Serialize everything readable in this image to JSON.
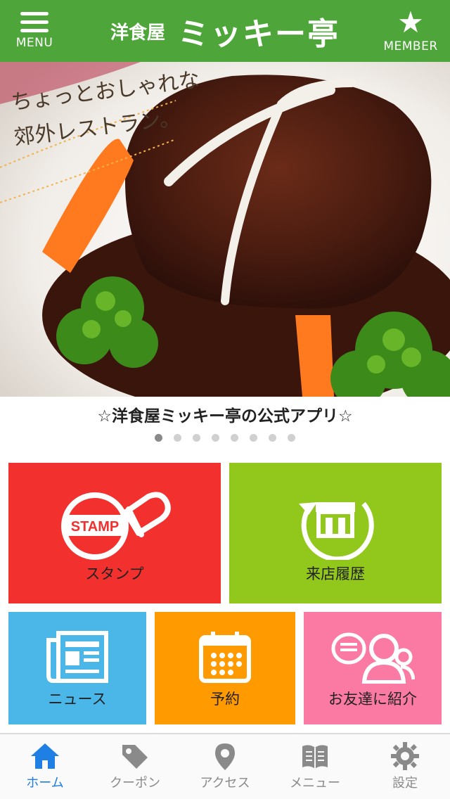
{
  "header": {
    "menu_label": "MENU",
    "member_label": "MEMBER",
    "title_prefix": "洋食屋",
    "title_main": "ミッキー亭",
    "brand_color": "#4ea63a"
  },
  "hero": {
    "tagline_line1": "ちょっとおしゃれな",
    "tagline_line2": "郊外レストラン。",
    "caption": "☆洋食屋ミッキー亭の公式アプリ☆",
    "slide_count": 8,
    "active_slide": 1
  },
  "tiles": {
    "stamp": {
      "label": "スタンプ",
      "badge": "STAMP",
      "color": "#f2302d"
    },
    "history": {
      "label": "来店履歴",
      "color": "#92c81c"
    },
    "news": {
      "label": "ニュース",
      "color": "#4ab7e8"
    },
    "reserve": {
      "label": "予約",
      "color": "#ff9a00"
    },
    "friend": {
      "label": "お友達に紹介",
      "color": "#fb7aa4"
    }
  },
  "tabbar": {
    "home": "ホーム",
    "coupon": "クーポン",
    "access": "アクセス",
    "menu": "メニュー",
    "settings": "設定",
    "active_color": "#1f7fe5"
  }
}
